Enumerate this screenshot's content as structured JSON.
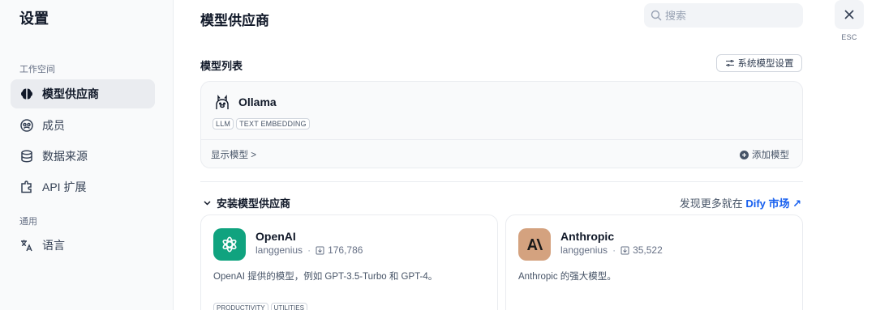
{
  "sidebar": {
    "title": "设置",
    "workspace_label": "工作空间",
    "general_label": "通用",
    "items": [
      {
        "label": "模型供应商",
        "icon": "brain-icon",
        "active": true
      },
      {
        "label": "成员",
        "icon": "members-icon",
        "active": false
      },
      {
        "label": "数据来源",
        "icon": "database-icon",
        "active": false
      },
      {
        "label": "API 扩展",
        "icon": "puzzle-icon",
        "active": false
      },
      {
        "label": "语言",
        "icon": "translate-icon",
        "active": false
      }
    ]
  },
  "header": {
    "title": "模型供应商",
    "search_placeholder": "搜索",
    "close_hint": "ESC"
  },
  "model_list": {
    "title": "模型列表",
    "system_settings_label": "系统模型设置",
    "providers": [
      {
        "name": "Ollama",
        "tags": [
          "LLM",
          "TEXT EMBEDDING"
        ],
        "show_models_label": "显示模型 >",
        "add_model_label": "添加模型"
      }
    ]
  },
  "install": {
    "title": "安装模型供应商",
    "marketplace_prefix": "发现更多就在 ",
    "marketplace_link": "Dify 市场 ↗",
    "plugins": [
      {
        "name": "OpenAI",
        "author": "langgenius",
        "installs": "176,786",
        "description": "OpenAI 提供的模型，例如 GPT-3.5-Turbo 和 GPT-4。",
        "tags": [
          "PRODUCTIVITY",
          "UTILITIES"
        ],
        "icon_color": "#10a37f"
      },
      {
        "name": "Anthropic",
        "author": "langgenius",
        "installs": "35,522",
        "description": "Anthropic 的强大模型。",
        "tags": [],
        "icon_color": "#d4a27f"
      }
    ]
  }
}
